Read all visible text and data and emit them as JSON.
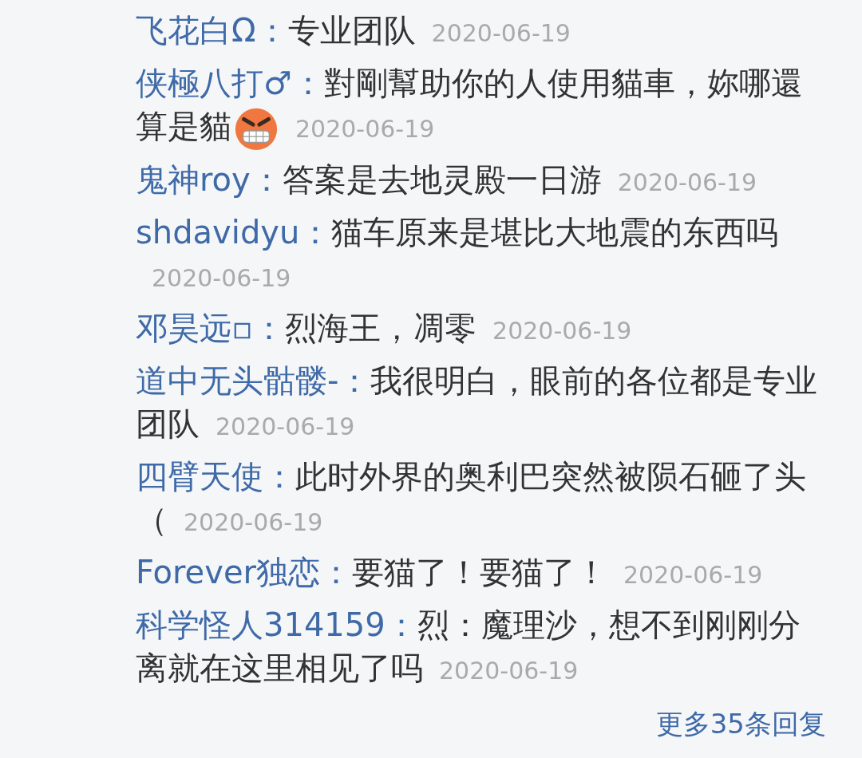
{
  "replies": [
    {
      "user": "飞花白Ω：",
      "text": "专业团队",
      "date": "2020-06-19"
    },
    {
      "user": "侠極八打♂：",
      "text": "對剛幫助你的人使用貓車，妳哪還算是貓",
      "angry_emoji": true,
      "date": "2020-06-19"
    },
    {
      "user": "鬼神roy：",
      "text": "答案是去地灵殿一日游",
      "date": "2020-06-19"
    },
    {
      "user": "shdavidyu：",
      "text": "猫车原来是堪比大地震的东西吗",
      "date": "2020-06-19"
    },
    {
      "user": "邓昊远▫：",
      "text": "烈海王，凋零",
      "date": "2020-06-19"
    },
    {
      "user": "道中无头骷髅-：",
      "text": "我很明白，眼前的各位都是专业团队",
      "date": "2020-06-19"
    },
    {
      "user": "四臂天使：",
      "text": "此时外界的奥利巴突然被陨石砸了头（",
      "date": "2020-06-19"
    },
    {
      "user": "Forever独恋：",
      "text": "要猫了！要猫了！",
      "date": "2020-06-19"
    },
    {
      "user": "科学怪人314159：",
      "text": "烈：魔理沙，想不到刚刚分离就在这里相见了吗",
      "date": "2020-06-19"
    }
  ],
  "more_link": "更多35条回复"
}
